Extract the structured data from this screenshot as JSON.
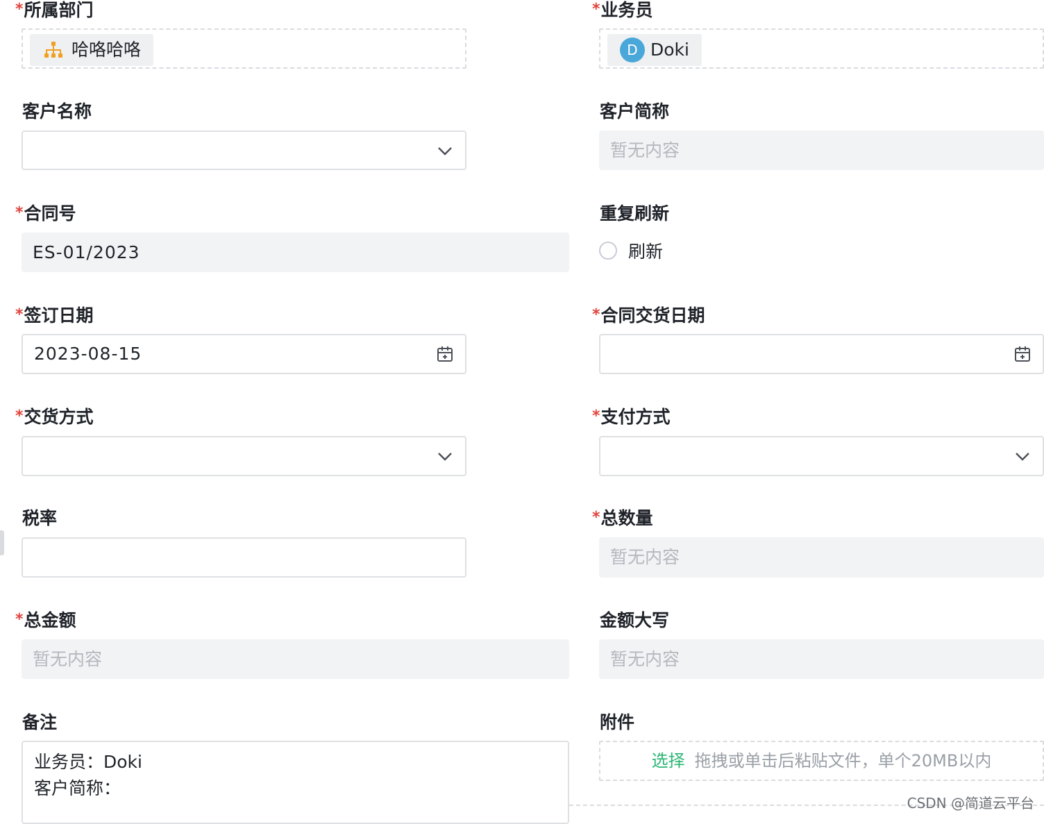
{
  "form": {
    "department": {
      "label": "所属部门",
      "required": true,
      "chip_text": "哈咯哈咯",
      "chip_icon": "org-chart-icon"
    },
    "salesperson": {
      "label": "业务员",
      "required": true,
      "avatar_letter": "D",
      "name": "Doki"
    },
    "customer_name": {
      "label": "客户名称",
      "required": false,
      "value": ""
    },
    "customer_short": {
      "label": "客户简称",
      "required": false,
      "placeholder": "暂无内容"
    },
    "contract_no": {
      "label": "合同号",
      "required": true,
      "value": "ES-01/2023"
    },
    "repeat_refresh": {
      "label": "重复刷新",
      "required": false,
      "option_label": "刷新"
    },
    "sign_date": {
      "label": "签订日期",
      "required": true,
      "value": "2023-08-15"
    },
    "delivery_date": {
      "label": "合同交货日期",
      "required": true,
      "value": ""
    },
    "delivery_method": {
      "label": "交货方式",
      "required": true,
      "value": ""
    },
    "payment_method": {
      "label": "支付方式",
      "required": true,
      "value": ""
    },
    "tax_rate": {
      "label": "税率",
      "required": false,
      "value": ""
    },
    "total_qty": {
      "label": "总数量",
      "required": true,
      "placeholder": "暂无内容"
    },
    "total_amount": {
      "label": "总金额",
      "required": true,
      "placeholder": "暂无内容"
    },
    "amount_upper": {
      "label": "金额大写",
      "required": false,
      "placeholder": "暂无内容"
    },
    "remarks": {
      "label": "备注",
      "required": false,
      "line1": "业务员：Doki",
      "line2": "客户简称："
    },
    "attachment": {
      "label": "附件",
      "required": false,
      "select_label": "选择",
      "hint": "拖拽或单击后粘贴文件，单个20MB以内"
    }
  },
  "required_mark": "*",
  "colors": {
    "required": "#e0443c",
    "link": "#2bb673",
    "avatar": "#4aa7d9",
    "org_icon": "#f0a020"
  },
  "watermark": "CSDN @简道云平台"
}
